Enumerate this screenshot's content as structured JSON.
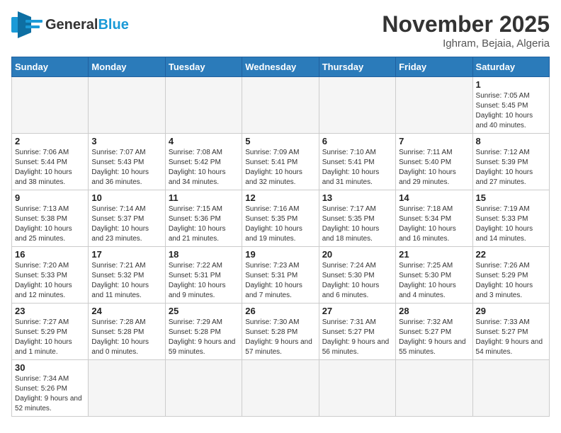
{
  "header": {
    "logo_general": "General",
    "logo_blue": "Blue",
    "month_title": "November 2025",
    "location": "Ighram, Bejaia, Algeria"
  },
  "weekdays": [
    "Sunday",
    "Monday",
    "Tuesday",
    "Wednesday",
    "Thursday",
    "Friday",
    "Saturday"
  ],
  "weeks": [
    [
      {
        "day": "",
        "info": ""
      },
      {
        "day": "",
        "info": ""
      },
      {
        "day": "",
        "info": ""
      },
      {
        "day": "",
        "info": ""
      },
      {
        "day": "",
        "info": ""
      },
      {
        "day": "",
        "info": ""
      },
      {
        "day": "1",
        "info": "Sunrise: 7:05 AM\nSunset: 5:45 PM\nDaylight: 10 hours and 40 minutes."
      }
    ],
    [
      {
        "day": "2",
        "info": "Sunrise: 7:06 AM\nSunset: 5:44 PM\nDaylight: 10 hours and 38 minutes."
      },
      {
        "day": "3",
        "info": "Sunrise: 7:07 AM\nSunset: 5:43 PM\nDaylight: 10 hours and 36 minutes."
      },
      {
        "day": "4",
        "info": "Sunrise: 7:08 AM\nSunset: 5:42 PM\nDaylight: 10 hours and 34 minutes."
      },
      {
        "day": "5",
        "info": "Sunrise: 7:09 AM\nSunset: 5:41 PM\nDaylight: 10 hours and 32 minutes."
      },
      {
        "day": "6",
        "info": "Sunrise: 7:10 AM\nSunset: 5:41 PM\nDaylight: 10 hours and 31 minutes."
      },
      {
        "day": "7",
        "info": "Sunrise: 7:11 AM\nSunset: 5:40 PM\nDaylight: 10 hours and 29 minutes."
      },
      {
        "day": "8",
        "info": "Sunrise: 7:12 AM\nSunset: 5:39 PM\nDaylight: 10 hours and 27 minutes."
      }
    ],
    [
      {
        "day": "9",
        "info": "Sunrise: 7:13 AM\nSunset: 5:38 PM\nDaylight: 10 hours and 25 minutes."
      },
      {
        "day": "10",
        "info": "Sunrise: 7:14 AM\nSunset: 5:37 PM\nDaylight: 10 hours and 23 minutes."
      },
      {
        "day": "11",
        "info": "Sunrise: 7:15 AM\nSunset: 5:36 PM\nDaylight: 10 hours and 21 minutes."
      },
      {
        "day": "12",
        "info": "Sunrise: 7:16 AM\nSunset: 5:35 PM\nDaylight: 10 hours and 19 minutes."
      },
      {
        "day": "13",
        "info": "Sunrise: 7:17 AM\nSunset: 5:35 PM\nDaylight: 10 hours and 18 minutes."
      },
      {
        "day": "14",
        "info": "Sunrise: 7:18 AM\nSunset: 5:34 PM\nDaylight: 10 hours and 16 minutes."
      },
      {
        "day": "15",
        "info": "Sunrise: 7:19 AM\nSunset: 5:33 PM\nDaylight: 10 hours and 14 minutes."
      }
    ],
    [
      {
        "day": "16",
        "info": "Sunrise: 7:20 AM\nSunset: 5:33 PM\nDaylight: 10 hours and 12 minutes."
      },
      {
        "day": "17",
        "info": "Sunrise: 7:21 AM\nSunset: 5:32 PM\nDaylight: 10 hours and 11 minutes."
      },
      {
        "day": "18",
        "info": "Sunrise: 7:22 AM\nSunset: 5:31 PM\nDaylight: 10 hours and 9 minutes."
      },
      {
        "day": "19",
        "info": "Sunrise: 7:23 AM\nSunset: 5:31 PM\nDaylight: 10 hours and 7 minutes."
      },
      {
        "day": "20",
        "info": "Sunrise: 7:24 AM\nSunset: 5:30 PM\nDaylight: 10 hours and 6 minutes."
      },
      {
        "day": "21",
        "info": "Sunrise: 7:25 AM\nSunset: 5:30 PM\nDaylight: 10 hours and 4 minutes."
      },
      {
        "day": "22",
        "info": "Sunrise: 7:26 AM\nSunset: 5:29 PM\nDaylight: 10 hours and 3 minutes."
      }
    ],
    [
      {
        "day": "23",
        "info": "Sunrise: 7:27 AM\nSunset: 5:29 PM\nDaylight: 10 hours and 1 minute."
      },
      {
        "day": "24",
        "info": "Sunrise: 7:28 AM\nSunset: 5:28 PM\nDaylight: 10 hours and 0 minutes."
      },
      {
        "day": "25",
        "info": "Sunrise: 7:29 AM\nSunset: 5:28 PM\nDaylight: 9 hours and 59 minutes."
      },
      {
        "day": "26",
        "info": "Sunrise: 7:30 AM\nSunset: 5:28 PM\nDaylight: 9 hours and 57 minutes."
      },
      {
        "day": "27",
        "info": "Sunrise: 7:31 AM\nSunset: 5:27 PM\nDaylight: 9 hours and 56 minutes."
      },
      {
        "day": "28",
        "info": "Sunrise: 7:32 AM\nSunset: 5:27 PM\nDaylight: 9 hours and 55 minutes."
      },
      {
        "day": "29",
        "info": "Sunrise: 7:33 AM\nSunset: 5:27 PM\nDaylight: 9 hours and 54 minutes."
      }
    ],
    [
      {
        "day": "30",
        "info": "Sunrise: 7:34 AM\nSunset: 5:26 PM\nDaylight: 9 hours and 52 minutes."
      },
      {
        "day": "",
        "info": ""
      },
      {
        "day": "",
        "info": ""
      },
      {
        "day": "",
        "info": ""
      },
      {
        "day": "",
        "info": ""
      },
      {
        "day": "",
        "info": ""
      },
      {
        "day": "",
        "info": ""
      }
    ]
  ]
}
